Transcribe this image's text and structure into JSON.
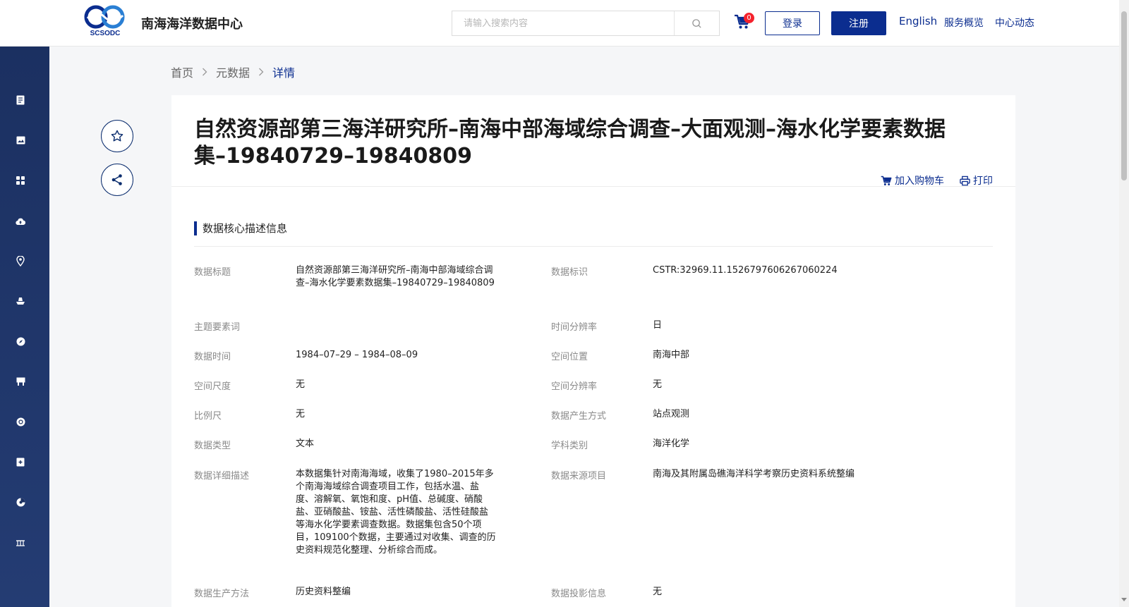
{
  "header": {
    "logo_text": "SCSODC",
    "site_name": "南海海洋数据中心",
    "search_placeholder": "请输入搜索内容",
    "cart_count": "0",
    "login_label": "登录",
    "register_label": "注册",
    "nav": {
      "english": "English",
      "services": "服务概览",
      "news": "中心动态"
    }
  },
  "sidebar": {
    "icons": [
      "document-icon",
      "image-icon",
      "grid-icon",
      "cloud-upload-icon",
      "location-pin-icon",
      "ship-icon",
      "compass-icon",
      "store-icon",
      "globe-icon",
      "plus-box-icon",
      "chart-pie-icon",
      "bridge-icon"
    ]
  },
  "breadcrumb": {
    "home": "首页",
    "metadata": "元数据",
    "current": "详情"
  },
  "detail": {
    "title": "自然资源部第三海洋研究所–南海中部海域综合调查–大面观测–海水化学要素数据集–19840729–19840809",
    "add_to_cart": "加入购物车",
    "print": "打印",
    "section_title": "数据核心描述信息",
    "fields": {
      "data_title_label": "数据标题",
      "data_title_value": "自然资源部第三海洋研究所–南海中部海域综合调查–海水化学要素数据集–19840729–19840809",
      "data_id_label": "数据标识",
      "data_id_value": "CSTR:32969.11.1526797606267060224",
      "keywords_label": "主题要素词",
      "keywords_value": "",
      "time_res_label": "时间分辨率",
      "time_res_value": "日",
      "data_time_label": "数据时间",
      "data_time_value": "1984–07–29 – 1984–08–09",
      "spatial_loc_label": "空间位置",
      "spatial_loc_value": "南海中部",
      "spatial_scale_label": "空间尺度",
      "spatial_scale_value": "无",
      "spatial_res_label": "空间分辨率",
      "spatial_res_value": "无",
      "scale_label": "比例尺",
      "scale_value": "无",
      "gen_method_label": "数据产生方式",
      "gen_method_value": "站点观测",
      "data_type_label": "数据类型",
      "data_type_value": "文本",
      "discipline_label": "学科类别",
      "discipline_value": "海洋化学",
      "desc_label": "数据详细描述",
      "desc_value": "本数据集针对南海海域，收集了1980–2015年多个南海海域综合调查项目工作，包括水温、盐度、溶解氧、氧饱和度、pH值、总碱度、硝酸盐、亚硝酸盐、铵盐、活性磷酸盐、活性硅酸盐等海水化学要素调查数据。数据集包含50个项目，109100个数据，主要通过对收集、调查的历史资料规范化整理、分析综合而成。",
      "source_project_label": "数据来源项目",
      "source_project_value": "南海及其附属岛礁海洋科学考察历史资料系统整编",
      "prod_method_label": "数据生产方法",
      "prod_method_value": "历史资料整编",
      "projection_label": "数据投影信息",
      "projection_value": "无"
    }
  },
  "colors": {
    "brand": "#0b2d8f",
    "sidebar": "#1b3061",
    "badge": "#f5222d"
  }
}
